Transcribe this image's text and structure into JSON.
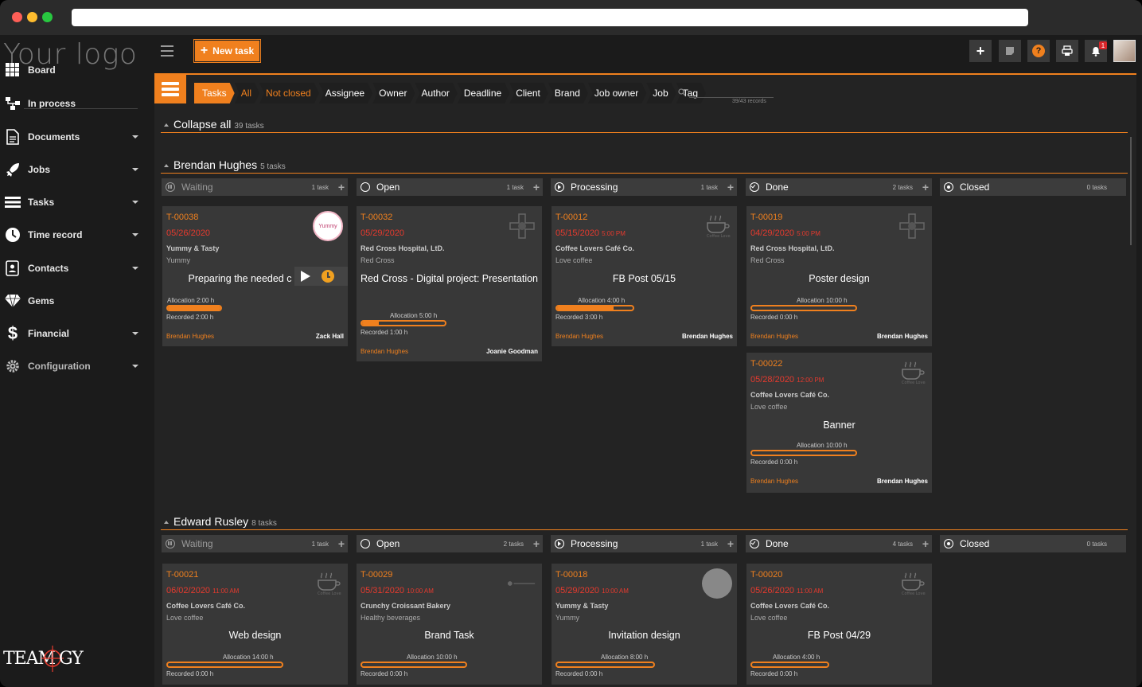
{
  "sidebar": {
    "logo_text": "Your logo",
    "items": [
      {
        "label": "Board",
        "icon": "grid-icon",
        "has_caret": false
      },
      {
        "label": "In process",
        "icon": "process-icon",
        "has_caret": false
      },
      {
        "label": "Documents",
        "icon": "document-icon",
        "has_caret": true
      },
      {
        "label": "Jobs",
        "icon": "rocket-icon",
        "has_caret": true
      },
      {
        "label": "Tasks",
        "icon": "tasks-icon",
        "has_caret": true
      },
      {
        "label": "Time record",
        "icon": "clock-icon",
        "has_caret": true
      },
      {
        "label": "Contacts",
        "icon": "contacts-icon",
        "has_caret": true
      },
      {
        "label": "Gems",
        "icon": "gem-icon",
        "has_caret": false
      },
      {
        "label": "Financial",
        "icon": "dollar-icon",
        "has_caret": true
      },
      {
        "label": "Configuration",
        "icon": "gear-icon",
        "has_caret": true
      }
    ],
    "brand_text": "TEAMOGY"
  },
  "toolbar": {
    "new_task_label": "New task",
    "notification_count": "1"
  },
  "filters": {
    "items": [
      "Tasks",
      "All",
      "Not closed",
      "Assignee",
      "Owner",
      "Author",
      "Deadline",
      "Client",
      "Brand",
      "Job owner",
      "Job",
      "Tag"
    ],
    "records": "39/43 records"
  },
  "collapse_all": {
    "label": "Collapse all",
    "count": "39 tasks"
  },
  "groups": [
    {
      "name": "Brendan Hughes",
      "count": "5 tasks",
      "columns": [
        {
          "label": "Waiting",
          "count": "1 task"
        },
        {
          "label": "Open",
          "count": "1 task"
        },
        {
          "label": "Processing",
          "count": "1 task"
        },
        {
          "label": "Done",
          "count": "2 tasks"
        },
        {
          "label": "Closed",
          "count": "0 tasks"
        }
      ],
      "cards": [
        {
          "id": "T-00038",
          "date": "05/26/2020",
          "time": "",
          "company": "Yummy & Tasty",
          "brand": "Yummy",
          "title": "Preparing the needed c",
          "alloc": "Allocation 2:00 h",
          "rec": "Recorded 2:00 h",
          "assignee": "Brendan Hughes",
          "owner": "Zack Hall",
          "progress": 1.0
        },
        {
          "id": "T-00032",
          "date": "05/29/2020",
          "time": "",
          "company": "Red Cross Hospital, LtD.",
          "brand": "Red Cross",
          "title": "Red Cross - Digital project: Presentation",
          "alloc": "Allocation 5:00 h",
          "rec": "Recorded 1:00 h",
          "assignee": "Brendan Hughes",
          "owner": "Joanie Goodman",
          "progress": 0.2
        },
        {
          "id": "T-00012",
          "date": "05/15/2020",
          "time": "5:00 PM",
          "company": "Coffee Lovers Café Co.",
          "brand": "Love coffee",
          "title": "FB Post 05/15",
          "alloc": "Allocation 4:00 h",
          "rec": "Recorded 3:00 h",
          "assignee": "Brendan Hughes",
          "owner": "Brendan Hughes",
          "progress": 0.75
        },
        {
          "id": "T-00019",
          "date": "04/29/2020",
          "time": "5:00 PM",
          "company": "Red Cross Hospital, LtD.",
          "brand": "Red Cross",
          "title": "Poster design",
          "alloc": "Allocation 10:00 h",
          "rec": "Recorded 0:00 h",
          "assignee": "Brendan Hughes",
          "owner": "Brendan Hughes",
          "progress": 0
        },
        {
          "id": "T-00022",
          "date": "05/28/2020",
          "time": "12:00 PM",
          "company": "Coffee Lovers Café Co.",
          "brand": "Love coffee",
          "title": "Banner",
          "alloc": "Allocation 10:00 h",
          "rec": "Recorded 0:00 h",
          "assignee": "Brendan Hughes",
          "owner": "Brendan Hughes",
          "progress": 0
        }
      ]
    },
    {
      "name": "Edward Rusley",
      "count": "8 tasks",
      "columns": [
        {
          "label": "Waiting",
          "count": "1 task"
        },
        {
          "label": "Open",
          "count": "2 tasks"
        },
        {
          "label": "Processing",
          "count": "1 task"
        },
        {
          "label": "Done",
          "count": "4 tasks"
        },
        {
          "label": "Closed",
          "count": "0 tasks"
        }
      ],
      "cards": [
        {
          "id": "T-00021",
          "date": "06/02/2020",
          "time": "11:00 AM",
          "company": "Coffee Lovers Café Co.",
          "brand": "Love coffee",
          "title": "Web design",
          "alloc": "Allocation 14:00 h",
          "rec": "Recorded 0:00 h",
          "progress": 0
        },
        {
          "id": "T-00029",
          "date": "05/31/2020",
          "time": "10:00 AM",
          "company": "Crunchy Croissant Bakery",
          "brand": "Healthy beverages",
          "title": "Brand Task",
          "alloc": "Allocation 10:00 h",
          "rec": "Recorded 0:00 h",
          "progress": 0
        },
        {
          "id": "T-00018",
          "date": "05/29/2020",
          "time": "10:00 AM",
          "company": "Yummy & Tasty",
          "brand": "Yummy",
          "title": "Invitation design",
          "alloc": "Allocation 8:00 h",
          "rec": "Recorded 0:00 h",
          "progress": 0
        },
        {
          "id": "T-00020",
          "date": "05/26/2020",
          "time": "11:00 AM",
          "company": "Coffee Lovers Café Co.",
          "brand": "Love coffee",
          "title": "FB Post 04/29",
          "alloc": "Allocation 4:00 h",
          "rec": "Recorded 0:00 h",
          "progress": 0
        }
      ]
    }
  ],
  "colors": {
    "accent": "#f0801e",
    "date_red": "#e63a2e",
    "bg": "#1b1b1b",
    "card": "#383838"
  }
}
